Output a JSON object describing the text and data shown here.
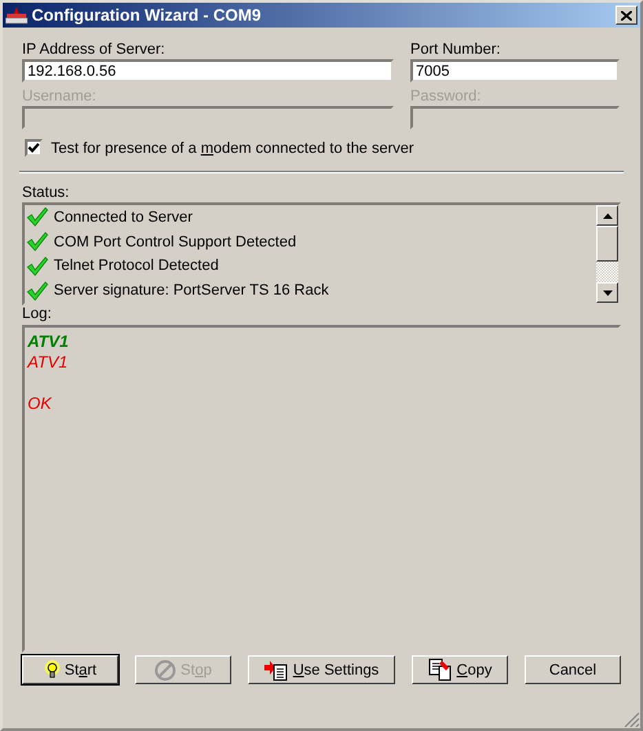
{
  "window": {
    "title": "Configuration Wizard - COM9"
  },
  "ip": {
    "label": "IP Address of Server:",
    "value": "192.168.0.56",
    "disabled": false
  },
  "port": {
    "label": "Port Number:",
    "value": "7005",
    "disabled": false
  },
  "username": {
    "label": "Username:",
    "disabled": true
  },
  "password": {
    "label": "Password:",
    "disabled": true
  },
  "modem_check": {
    "label": "Test for presence of a modem connected to the server",
    "checked": true
  },
  "status": {
    "label": "Status:",
    "items": [
      {
        "text": "Connected to Server",
        "ok": true
      },
      {
        "text": "COM Port Control Support Detected",
        "ok": true
      },
      {
        "text": "Telnet Protocol Detected",
        "ok": true
      },
      {
        "text": "Server signature: PortServer TS 16 Rack",
        "ok": true
      }
    ]
  },
  "log": {
    "label": "Log:",
    "lines": [
      {
        "text": "ATV1",
        "color": "#008000",
        "bold": true,
        "gap_before": false
      },
      {
        "text": "ATV1",
        "color": "#e00000",
        "bold": false,
        "gap_before": false
      },
      {
        "text": "OK",
        "color": "#e00000",
        "bold": false,
        "gap_before": true
      }
    ]
  },
  "buttons": [
    {
      "label": "Start",
      "kind": "start",
      "disabled": false,
      "default": true
    },
    {
      "label": "Stop",
      "kind": "stop",
      "disabled": true,
      "default": false
    },
    {
      "label": "Use Settings",
      "kind": "apply",
      "disabled": false,
      "default": false
    },
    {
      "label": "Copy",
      "kind": "copy",
      "disabled": false,
      "default": false
    },
    {
      "label": "Cancel",
      "kind": "cancel",
      "disabled": false,
      "default": false
    }
  ]
}
